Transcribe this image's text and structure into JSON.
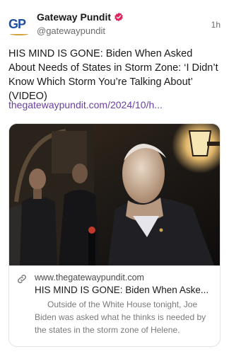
{
  "post": {
    "author": {
      "display_name": "Gateway Pundit",
      "handle": "@gatewaypundit",
      "avatar_text": "GP",
      "verified_color": "#e0245e"
    },
    "time": "1h",
    "text": "HIS MIND IS GONE: Biden When Asked About Needs of States in Storm Zone: ‘I Didn’t Know Which Storm You’re Talking About’ (VIDEO)",
    "link_text": "thegatewaypundit.com/2024/10/h...",
    "link_color": "#6b3fa0",
    "card": {
      "domain": "www.thegatewaypundit.com",
      "title": "HIS MIND IS GONE: Biden When Aske...",
      "description": "Outside of the White House tonight, Joe Biden was asked what he thinks is needed by the states in the storm zone of Helene.",
      "link_icon": "link-icon"
    }
  }
}
